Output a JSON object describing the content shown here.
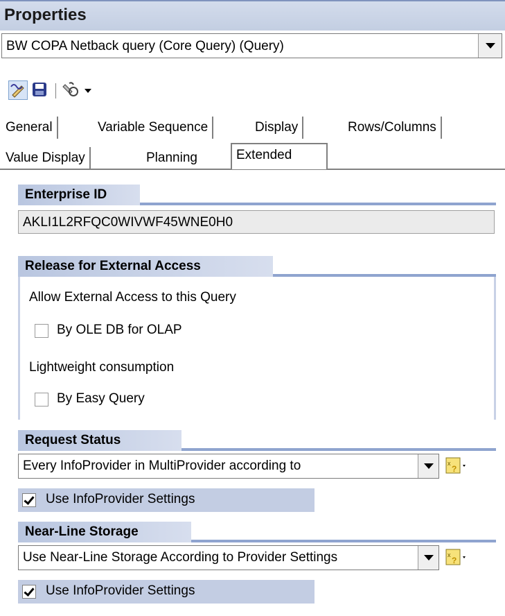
{
  "panel": {
    "title": "Properties"
  },
  "object_selector": {
    "value": "BW COPA Netback query (Core Query) (Query)"
  },
  "toolbar": {
    "icons": [
      "edit-icon",
      "save-icon",
      "tools-icon",
      "chevron-down-icon"
    ]
  },
  "tabs": {
    "row1": [
      "General",
      "Variable Sequence",
      "Display",
      "Rows/Columns"
    ],
    "row2": [
      "Value Display",
      "Planning",
      "Extended"
    ],
    "active": "Extended"
  },
  "enterprise_id": {
    "header": "Enterprise ID",
    "value": "AKLI1L2RFQC0WIVWF45WNE0H0"
  },
  "external_access": {
    "header": "Release for External Access",
    "allow_label": "Allow External Access to this Query",
    "ole_db_label": "By OLE DB for OLAP",
    "ole_db_checked": false,
    "lightweight_label": "Lightweight consumption",
    "easy_query_label": "By Easy Query",
    "easy_query_checked": false
  },
  "request_status": {
    "header": "Request Status",
    "value": "Every InfoProvider in MultiProvider according to",
    "use_settings_label": "Use InfoProvider Settings",
    "use_settings_checked": true
  },
  "near_line": {
    "header": "Near-Line Storage",
    "value": "Use Near-Line Storage According to Provider Settings",
    "use_settings_label": "Use InfoProvider Settings",
    "use_settings_checked": true
  }
}
